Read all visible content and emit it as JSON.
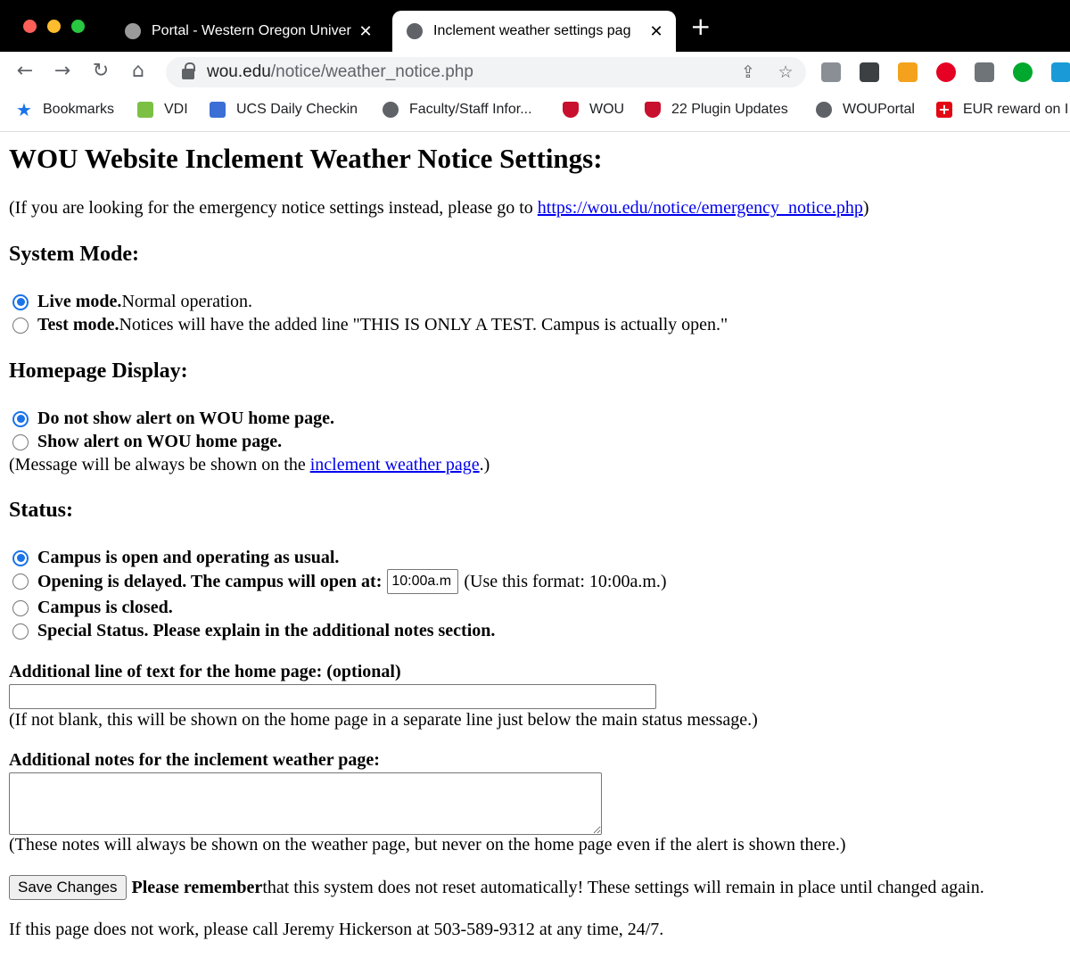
{
  "browser": {
    "tabs": [
      {
        "title": "Portal - Western Oregon Univer",
        "active": false
      },
      {
        "title": "Inclement weather settings pag",
        "active": true
      }
    ],
    "url_host": "wou.edu",
    "url_path": "/notice/weather_notice.php",
    "bookmarks": [
      {
        "label": "Bookmarks",
        "icon": "star-icon"
      },
      {
        "label": "VDI",
        "icon": "vdi-icon"
      },
      {
        "label": "UCS Daily Checkin",
        "icon": "calendar-icon"
      },
      {
        "label": "Faculty/Staff Infor...",
        "icon": "globe-icon"
      },
      {
        "label": "WOU",
        "icon": "wou-shield-icon"
      },
      {
        "label": "22 Plugin Updates",
        "icon": "wou-shield-icon"
      },
      {
        "label": "WOUPortal",
        "icon": "globe-icon"
      },
      {
        "label": "EUR reward on I",
        "icon": "swiss-cross-icon"
      }
    ]
  },
  "page": {
    "title": "WOU Website Inclement Weather Notice Settings:",
    "intro_prefix": "(If you are looking for the emergency notice settings instead, please go to ",
    "intro_link": "https://wou.edu/notice/emergency_notice.php",
    "intro_suffix": ")",
    "system_mode": {
      "heading": "System Mode:",
      "live_bold": "Live mode.",
      "live_text": " Normal operation.",
      "test_bold": "Test mode.",
      "test_text": " Notices will have the added line \"THIS IS ONLY A TEST. Campus is actually open.\"",
      "selected": "live"
    },
    "homepage": {
      "heading": "Homepage Display:",
      "no_show": "Do not show alert on WOU home page.",
      "show": "Show alert on WOU home page.",
      "note_prefix": "(Message will be always be shown on the ",
      "note_link": "inclement weather page",
      "note_suffix": ".)",
      "selected": "no_show"
    },
    "status": {
      "heading": "Status:",
      "open": "Campus is open and operating as usual.",
      "delayed": "Opening is delayed. The campus will open at:",
      "delayed_value": "10:00a.m",
      "delayed_hint": "(Use this format: 10:00a.m.)",
      "closed": "Campus is closed.",
      "special": "Special Status. Please explain in the additional notes section.",
      "selected": "open"
    },
    "additional_line": {
      "label": "Additional line of text for the home page: (optional)",
      "value": "",
      "note": "(If not blank, this will be shown on the home page in a separate line just below the main status message.)"
    },
    "additional_notes": {
      "label": "Additional notes for the inclement weather page:",
      "value": "",
      "note": "(These notes will always be shown on the weather page, but never on the home page even if the alert is shown there.)"
    },
    "save": {
      "button": "Save Changes",
      "remember_bold": "Please remember",
      "remember_text": " that this system does not reset automatically! These settings will remain in place until changed again."
    },
    "footer": "If this page does not work, please call Jeremy Hickerson at 503-589-9312 at any time, 24/7."
  }
}
